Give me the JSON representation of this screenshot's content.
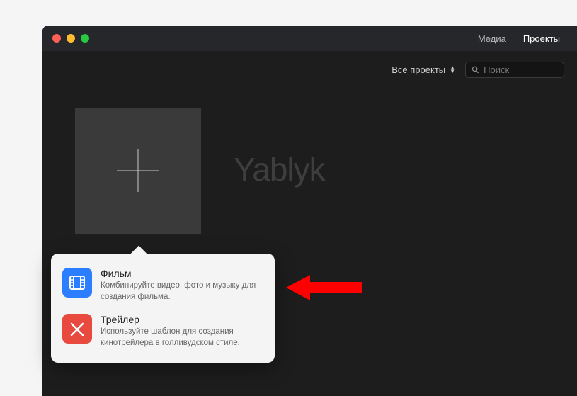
{
  "tabs": {
    "media": "Медиа",
    "projects": "Проекты"
  },
  "toolbar": {
    "filter_label": "Все проекты"
  },
  "search": {
    "placeholder": "Поиск"
  },
  "watermark": "Yablyk",
  "popover": {
    "movie": {
      "title": "Фильм",
      "desc": "Комбинируйте видео, фото и музыку для создания фильма."
    },
    "trailer": {
      "title": "Трейлер",
      "desc": "Используйте шаблон для создания кинотрейлера в голливудском стиле."
    }
  }
}
